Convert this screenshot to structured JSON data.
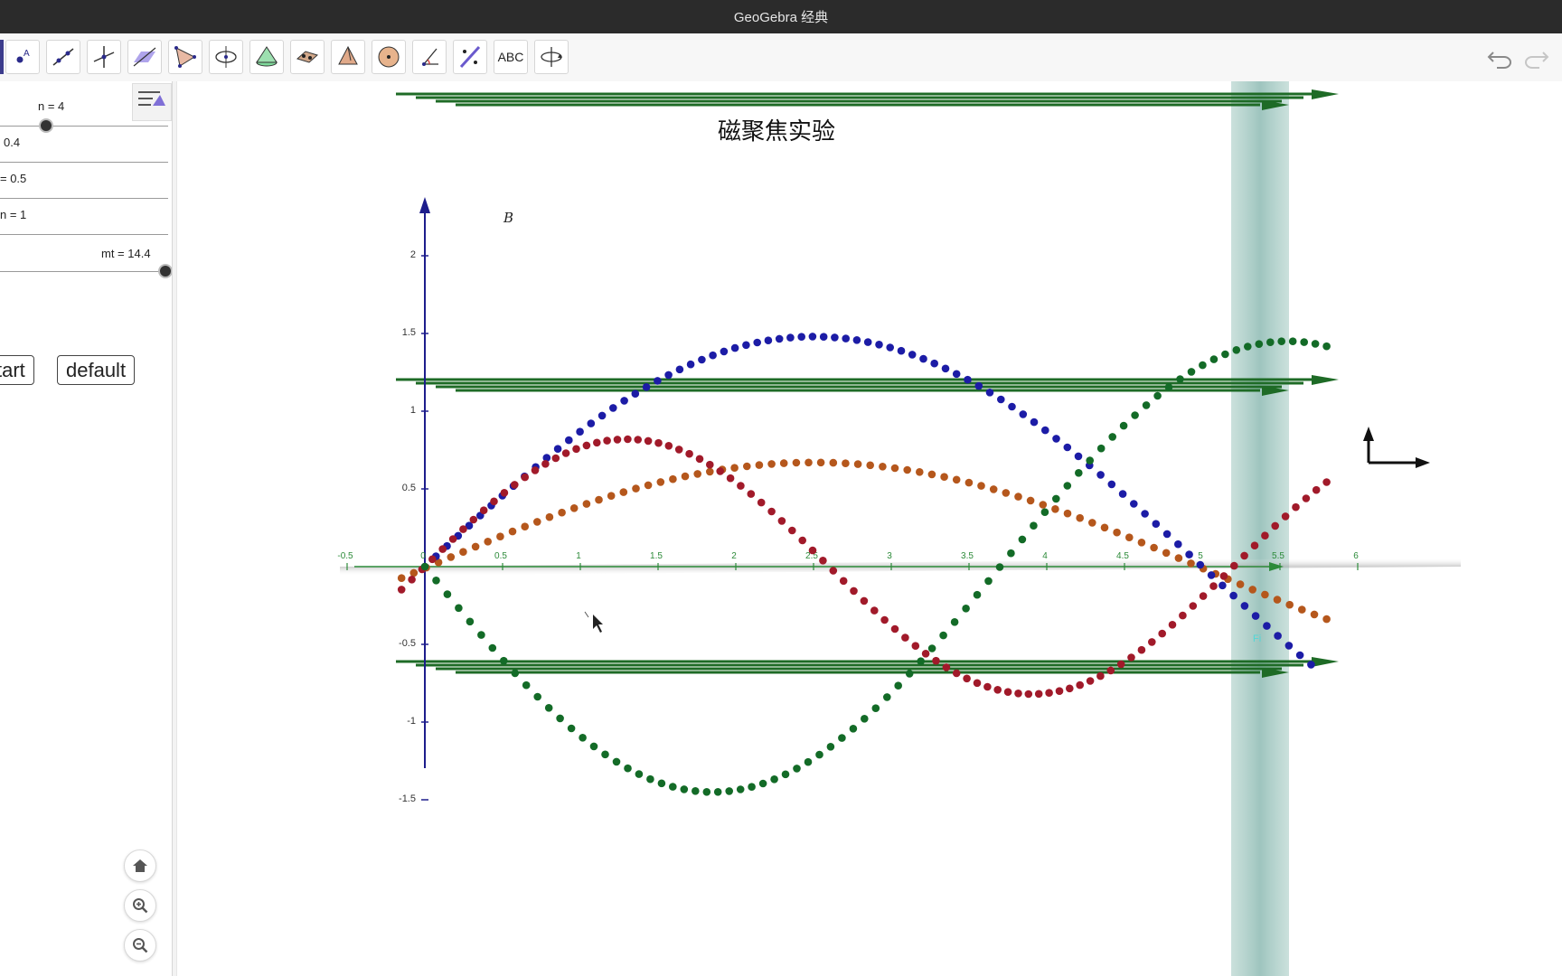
{
  "window": {
    "title": "GeoGebra 经典"
  },
  "toolbar": {
    "tools": [
      {
        "name": "point-tool-icon"
      },
      {
        "name": "line-tool-icon"
      },
      {
        "name": "perpendicular-tool-icon"
      },
      {
        "name": "polygon-tool-icon"
      },
      {
        "name": "circle-axis-tool-icon"
      },
      {
        "name": "sphere-cone-tool-icon"
      },
      {
        "name": "intersect-surfaces-tool-icon"
      },
      {
        "name": "pyramid-tool-icon"
      },
      {
        "name": "sphere-tool-icon"
      },
      {
        "name": "angle-tool-icon"
      },
      {
        "name": "reflect-tool-icon"
      },
      {
        "name": "text-tool",
        "label": "ABC"
      },
      {
        "name": "rotate-view-tool-icon"
      }
    ],
    "undo_icon": "undo-icon",
    "redo_icon": "redo-icon"
  },
  "algebra": {
    "sliders": [
      {
        "label": "n = 4",
        "value": 4,
        "position": 0.25
      },
      {
        "label": "0.4",
        "position": 0.0
      },
      {
        "label": "= 0.5",
        "position": 0.0
      },
      {
        "label": "n = 1",
        "position": null
      },
      {
        "label": "mt = 14.4",
        "value": 14.4,
        "position": 0.96
      }
    ],
    "buttons": {
      "start": "tart",
      "default": "default"
    },
    "style_icon": "graphics-style-icon",
    "nav": {
      "home": "home-icon",
      "zoom_in": "zoom-in-icon",
      "zoom_out": "zoom-out-icon"
    }
  },
  "graphics": {
    "title": "磁聚焦实验",
    "axis_label": "B",
    "y_ticks": [
      "2",
      "1.5",
      "1",
      "0.5",
      "-0.5",
      "-1",
      "-1.5"
    ],
    "x_ticks": [
      "-0.5",
      "0",
      "0.5",
      "1",
      "1.5",
      "2",
      "2.5",
      "3",
      "3.5",
      "4",
      "4.5",
      "5",
      "5.5",
      "6"
    ]
  }
}
